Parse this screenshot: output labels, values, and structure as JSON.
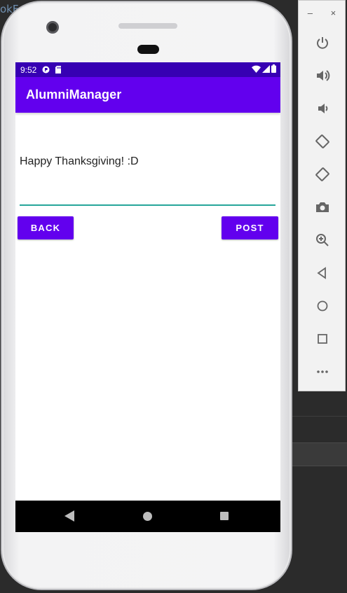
{
  "ide": {
    "partial_text": "okF"
  },
  "status_bar": {
    "time": "9:52"
  },
  "app": {
    "title": "AlumniManager"
  },
  "content": {
    "message": "Happy Thanksgiving! :D",
    "back_label": "BACK",
    "post_label": "POST"
  },
  "emulator_toolbar": {
    "minimize": "–",
    "close": "×",
    "items": [
      "power-icon",
      "volume-up-icon",
      "volume-down-icon",
      "rotate-left-icon",
      "rotate-right-icon",
      "camera-icon",
      "zoom-icon",
      "back-icon",
      "home-icon",
      "overview-icon",
      "more-icon"
    ]
  },
  "colors": {
    "status_bar": "#3700b3",
    "app_bar": "#6200ee",
    "accent": "#26a69a",
    "button": "#6200ee"
  }
}
